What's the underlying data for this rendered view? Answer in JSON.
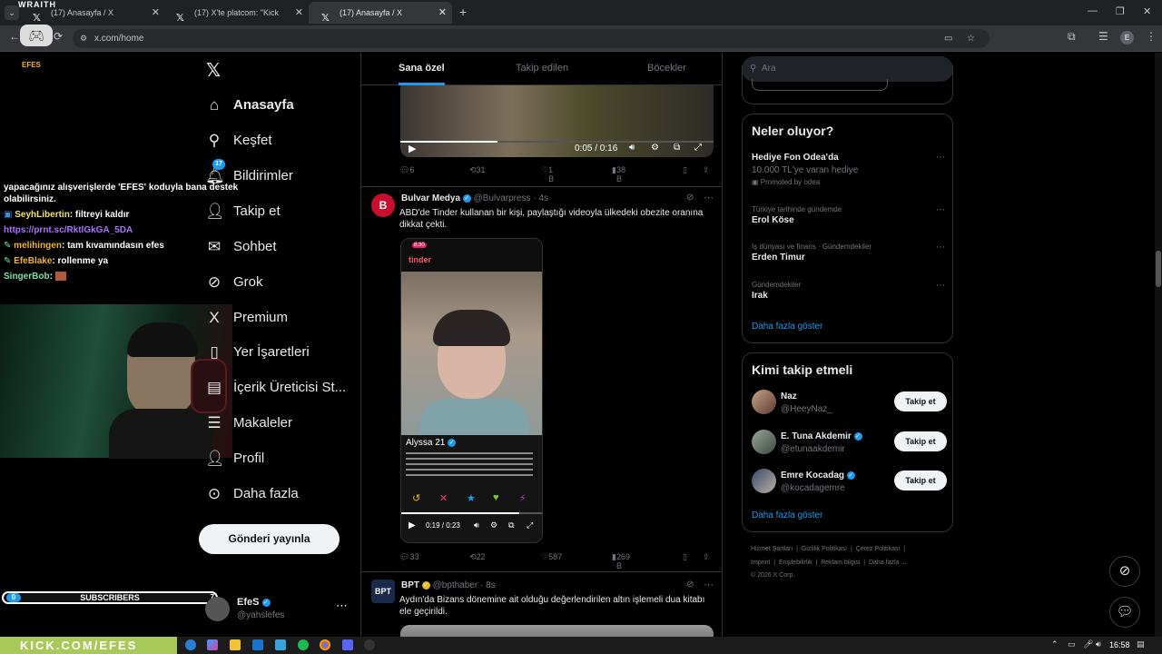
{
  "browser": {
    "tabs": [
      {
        "label": "(17) Anasayfa / X"
      },
      {
        "label": "(17) X'te platcom: \"Kick yayıncı..."
      },
      {
        "label": "(17) Anasayfa / X"
      }
    ],
    "url": "x.com/home",
    "profile_initial": "E"
  },
  "stream": {
    "top_logo": "WRAITH",
    "sub_logo": "EFES",
    "chat": [
      {
        "user": "",
        "text": "yapacağınız alışverişlerde 'EFES' koduyla bana destek olabilirsiniz.",
        "color": "#ffffff"
      },
      {
        "user": "SeyhLibertin",
        "text": ": filtreyi kaldır",
        "color": "#f3e36b"
      },
      {
        "user": "",
        "text": "https://prnt.sc/RktlGkGA_5DA",
        "color": "#a970ff"
      },
      {
        "user": "melihingen",
        "text": ": tam kıvamındasın efes",
        "color": "#f0b429"
      },
      {
        "user": "EfeBlake",
        "text": ": rollenme ya",
        "color": "#f0b429"
      },
      {
        "user": "SingerBob",
        "text": ":",
        "color": "#7ee0a7"
      }
    ],
    "subscribers_label": "SUBSCRIBERS",
    "subscribers_count": "0",
    "subscribers_goal": "7",
    "ticker": "KICK.COM/EFES"
  },
  "nav": {
    "items": [
      {
        "label": "Anasayfa",
        "icon": "home-icon",
        "glyph": "⌂"
      },
      {
        "label": "Keşfet",
        "icon": "search-icon",
        "glyph": "⚲"
      },
      {
        "label": "Bildirimler",
        "icon": "bell-icon",
        "glyph": "🔔︎",
        "badge": "17"
      },
      {
        "label": "Takip et",
        "icon": "add-person-icon",
        "glyph": "👤︎"
      },
      {
        "label": "Sohbet",
        "icon": "mail-icon",
        "glyph": "✉"
      },
      {
        "label": "Grok",
        "icon": "grok-icon",
        "glyph": "⊘"
      },
      {
        "label": "Premium",
        "icon": "premium-icon",
        "glyph": "X"
      },
      {
        "label": "Yer İşaretleri",
        "icon": "bookmark-icon",
        "glyph": "▯"
      },
      {
        "label": "İçerik Üreticisi St...",
        "icon": "creator-studio-icon",
        "glyph": "▤"
      },
      {
        "label": "Makaleler",
        "icon": "article-icon",
        "glyph": "☰"
      },
      {
        "label": "Profil",
        "icon": "profile-icon",
        "glyph": "👤︎"
      },
      {
        "label": "Daha fazla",
        "icon": "more-circle-icon",
        "glyph": "⊙"
      }
    ],
    "post_button": "Gönderi yayınla",
    "account": {
      "name": "EfeS",
      "handle": "@yahslefes"
    }
  },
  "feed": {
    "tabs": [
      "Sana özel",
      "Takip edilen",
      "Böcekler"
    ],
    "video1": {
      "time": "0:05 / 0:16"
    },
    "post0_actions": {
      "replies": "6",
      "reposts": "31",
      "likes": "1 B",
      "views": "38 B"
    },
    "post1": {
      "name": "Bulvar Medya",
      "handle": "@Bulvarpress",
      "time": "4s",
      "text": "ABD'de Tinder kullanan bir kişi, paylaştığı videoyla ülkedeki obezite oranına dikkat çekti.",
      "video": {
        "brand": "tinder",
        "profile_name": "Alyssa",
        "age": "21",
        "time": "0:19 / 0:23",
        "clock": "8:30"
      },
      "actions": {
        "replies": "33",
        "reposts": "22",
        "likes": "587",
        "views": "269 B"
      }
    },
    "post2": {
      "name": "BPT",
      "handle": "@bpthaber",
      "time": "8s",
      "text": "Aydın'da Bizans dönemine ait olduğu değerlendirilen altın işlemeli dua kitabı ele geçirildi."
    }
  },
  "right": {
    "search_placeholder": "Ara",
    "whats_happening": {
      "title": "Neler oluyor?",
      "items": [
        {
          "context": "",
          "name": "Hediye Fon Odea'da",
          "sub": "10.000 TL'ye varan hediye",
          "promo": "Promoted by odea"
        },
        {
          "context": "Türkiye tarihinde gündemde",
          "name": "Erol Köse"
        },
        {
          "context": "İş dünyası ve finans · Gündemdekiler",
          "name": "Erden Timur"
        },
        {
          "context": "Gündemdekiler",
          "name": "Irak"
        }
      ],
      "show_more": "Daha fazla göster"
    },
    "who_to_follow": {
      "title": "Kimi takip etmeli",
      "users": [
        {
          "name": "Naz",
          "handle": "@HeeyNaz_",
          "verified": false
        },
        {
          "name": "E. Tuna Akdemir",
          "handle": "@etunaakdemir",
          "verified": true
        },
        {
          "name": "Emre Kocadag",
          "handle": "@kocadagemre",
          "verified": true
        }
      ],
      "follow_label": "Takip et",
      "show_more": "Daha fazla göster"
    },
    "footer": {
      "line1": [
        "Hizmet Şartları",
        "Gizlilik Politikası",
        "Çerez Politikası"
      ],
      "line2": [
        "Imprint",
        "Erişilebilirlik",
        "Reklam bilgisi",
        "Daha fazla ..."
      ],
      "copyright": "© 2026 X Corp."
    }
  },
  "taskbar": {
    "time": "16:58"
  }
}
